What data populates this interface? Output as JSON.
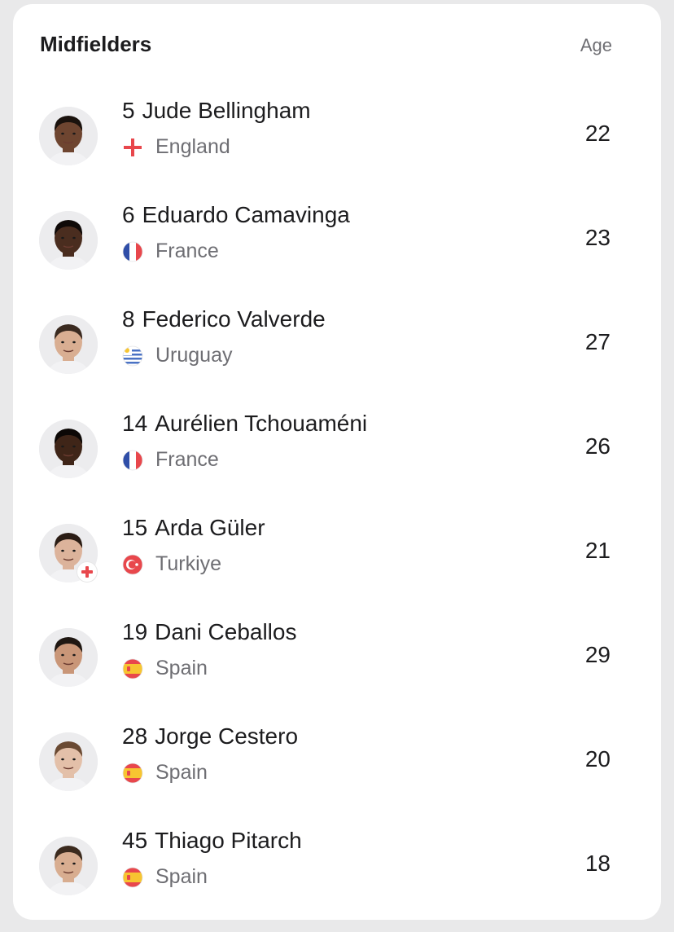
{
  "section": {
    "title": "Midfielders",
    "age_label": "Age"
  },
  "players": [
    {
      "number": "5",
      "name": "Jude Bellingham",
      "country": "England",
      "flag": "england-flag",
      "age": "22",
      "skin": "#6e4530",
      "hair": "#1a120d",
      "badge": false
    },
    {
      "number": "6",
      "name": "Eduardo Camavinga",
      "country": "France",
      "flag": "france-flag",
      "age": "23",
      "skin": "#4a2d1f",
      "hair": "#0f0a08",
      "badge": false
    },
    {
      "number": "8",
      "name": "Federico Valverde",
      "country": "Uruguay",
      "flag": "uruguay-flag",
      "age": "27",
      "skin": "#d9ae92",
      "hair": "#3a2a20",
      "badge": false
    },
    {
      "number": "14",
      "name": "Aurélien Tchouaméni",
      "country": "France",
      "flag": "france-flag",
      "age": "26",
      "skin": "#3f2518",
      "hair": "#0c0806",
      "badge": false
    },
    {
      "number": "15",
      "name": "Arda Güler",
      "country": "Turkiye",
      "flag": "turkey-flag",
      "age": "21",
      "skin": "#dcb39b",
      "hair": "#2b1d15",
      "badge": true
    },
    {
      "number": "19",
      "name": "Dani Ceballos",
      "country": "Spain",
      "flag": "spain-flag",
      "age": "29",
      "skin": "#c99678",
      "hair": "#1f1712",
      "badge": false
    },
    {
      "number": "28",
      "name": "Jorge Cestero",
      "country": "Spain",
      "flag": "spain-flag",
      "age": "20",
      "skin": "#e3c0a9",
      "hair": "#6a4a33",
      "badge": false
    },
    {
      "number": "45",
      "name": "Thiago Pitarch",
      "country": "Spain",
      "flag": "spain-flag",
      "age": "18",
      "skin": "#d8ad90",
      "hair": "#3b2a1e",
      "badge": false
    }
  ],
  "colors": {
    "card": "#ffffff",
    "background": "#e9e9ea",
    "text": "#1c1c1e",
    "muted": "#6e6e73",
    "flag_red": "#e8474c",
    "flag_blue": "#2f4ea8",
    "flag_yellow": "#f7c531",
    "shirt": "#f2f2f4"
  }
}
